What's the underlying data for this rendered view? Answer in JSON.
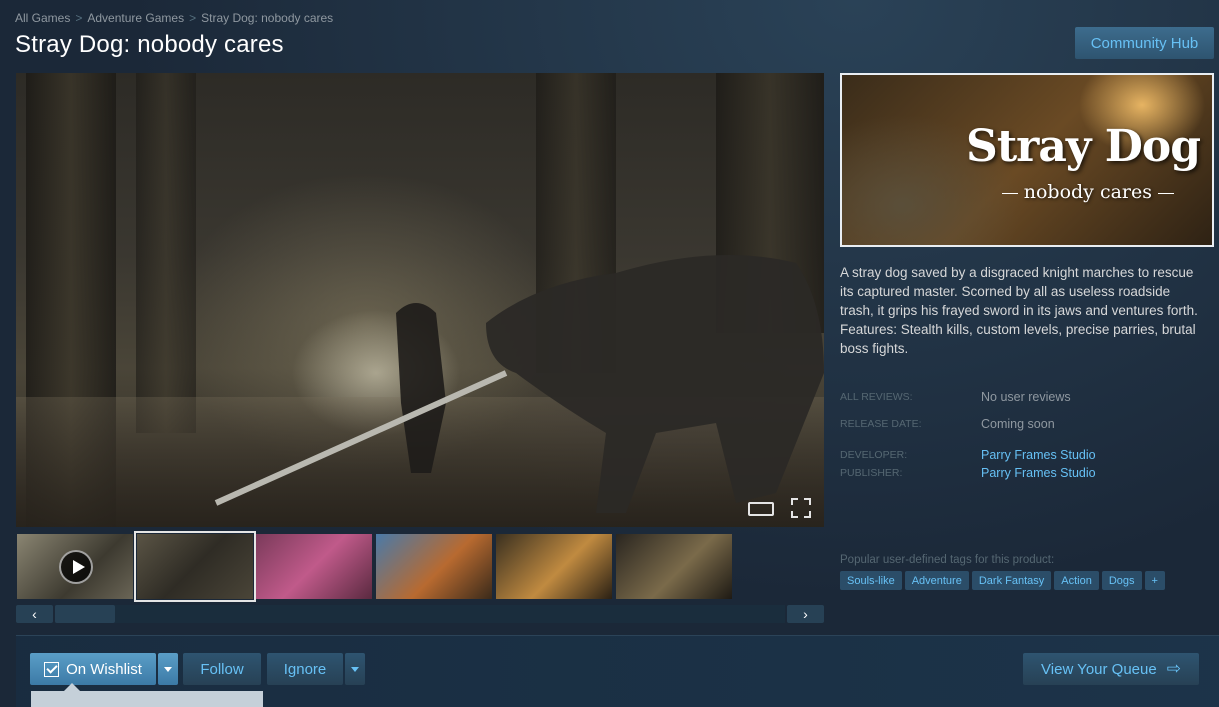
{
  "breadcrumb": {
    "items": [
      "All Games",
      "Adventure Games",
      "Stray Dog: nobody cares"
    ],
    "separator": ">"
  },
  "header": {
    "title": "Stray Dog: nobody cares",
    "community_hub_label": "Community Hub"
  },
  "media": {
    "controls": {
      "widescreen": "widescreen-icon",
      "fullscreen": "fullscreen-icon"
    },
    "slider": {
      "prev_label": "‹",
      "next_label": "›"
    }
  },
  "capsule": {
    "title": "Stray Dog",
    "subtitle": "nobody cares"
  },
  "description": "A stray dog saved by a disgraced knight marches to rescue its captured master. Scorned by all as useless roadside trash, it grips his frayed sword in its jaws and ventures forth. Features: Stealth kills, custom levels, precise parries, brutal boss fights.",
  "meta": {
    "reviews_label": "ALL REVIEWS:",
    "reviews_value": "No user reviews",
    "release_label": "RELEASE DATE:",
    "release_value": "Coming soon",
    "developer_label": "DEVELOPER:",
    "developer_value": "Parry Frames Studio",
    "publisher_label": "PUBLISHER:",
    "publisher_value": "Parry Frames Studio"
  },
  "tags": {
    "label": "Popular user-defined tags for this product:",
    "items": [
      "Souls-like",
      "Adventure",
      "Dark Fantasy",
      "Action",
      "Dogs",
      "+"
    ]
  },
  "actions": {
    "wishlist_label": "On Wishlist",
    "follow_label": "Follow",
    "ignore_label": "Ignore",
    "queue_label": "View Your Queue",
    "queue_arrow": "⇨"
  },
  "colors": {
    "accent": "#67c1f5",
    "background": "#1b2838",
    "wishlist": "#4a8cba"
  }
}
